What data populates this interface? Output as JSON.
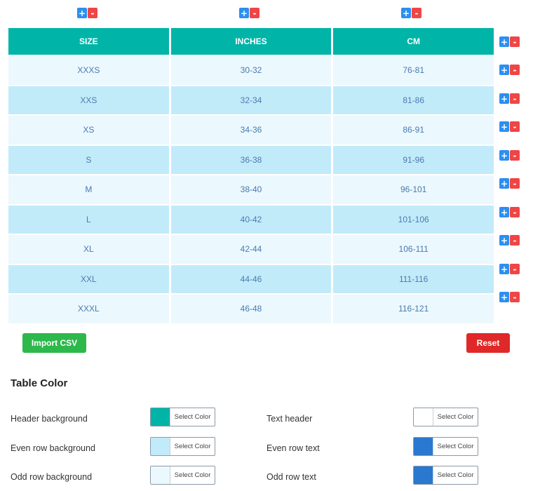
{
  "table": {
    "headers": [
      "SIZE",
      "INCHES",
      "CM"
    ],
    "rows": [
      [
        "XXXS",
        "30-32",
        "76-81"
      ],
      [
        "XXS",
        "32-34",
        "81-86"
      ],
      [
        "XS",
        "34-36",
        "86-91"
      ],
      [
        "S",
        "36-38",
        "91-96"
      ],
      [
        "M",
        "38-40",
        "96-101"
      ],
      [
        "L",
        "40-42",
        "101-106"
      ],
      [
        "XL",
        "42-44",
        "106-111"
      ],
      [
        "XXL",
        "44-46",
        "111-116"
      ],
      [
        "XXXL",
        "46-48",
        "116-121"
      ]
    ]
  },
  "controls": {
    "plus": "+",
    "minus": "-"
  },
  "actions": {
    "import_label": "Import CSV",
    "reset_label": "Reset"
  },
  "table_color": {
    "title": "Table Color",
    "select_label": "Select Color",
    "header_background": {
      "label": "Header background",
      "color": "#00b4a8"
    },
    "even_row_background": {
      "label": "Even row background",
      "color": "#c2ebfa"
    },
    "odd_row_background": {
      "label": "Odd row background",
      "color": "#ebf8fd"
    },
    "text_header": {
      "label": "Text header",
      "color": "#ffffff"
    },
    "even_row_text": {
      "label": "Even row text",
      "color": "#2a78d0"
    },
    "odd_row_text": {
      "label": "Odd row text",
      "color": "#2a78d0"
    }
  }
}
